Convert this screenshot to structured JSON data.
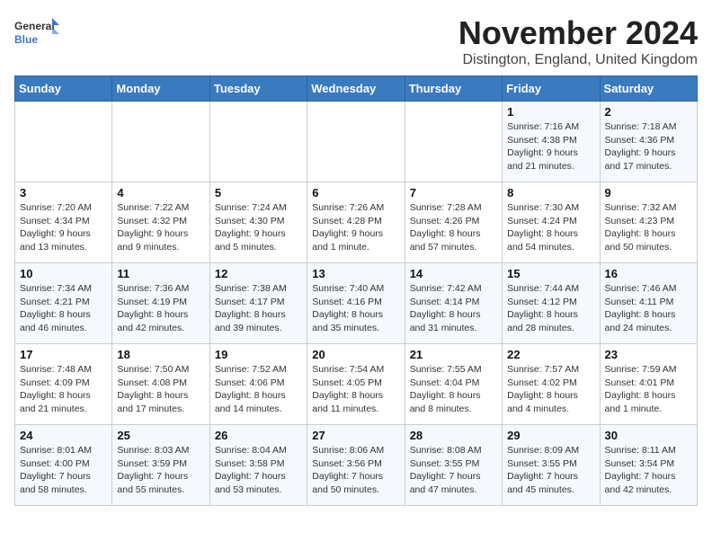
{
  "logo": {
    "general": "General",
    "blue": "Blue"
  },
  "title": "November 2024",
  "subtitle": "Distington, England, United Kingdom",
  "headers": [
    "Sunday",
    "Monday",
    "Tuesday",
    "Wednesday",
    "Thursday",
    "Friday",
    "Saturday"
  ],
  "weeks": [
    [
      {
        "day": "",
        "info": ""
      },
      {
        "day": "",
        "info": ""
      },
      {
        "day": "",
        "info": ""
      },
      {
        "day": "",
        "info": ""
      },
      {
        "day": "",
        "info": ""
      },
      {
        "day": "1",
        "info": "Sunrise: 7:16 AM\nSunset: 4:38 PM\nDaylight: 9 hours\nand 21 minutes."
      },
      {
        "day": "2",
        "info": "Sunrise: 7:18 AM\nSunset: 4:36 PM\nDaylight: 9 hours\nand 17 minutes."
      }
    ],
    [
      {
        "day": "3",
        "info": "Sunrise: 7:20 AM\nSunset: 4:34 PM\nDaylight: 9 hours\nand 13 minutes."
      },
      {
        "day": "4",
        "info": "Sunrise: 7:22 AM\nSunset: 4:32 PM\nDaylight: 9 hours\nand 9 minutes."
      },
      {
        "day": "5",
        "info": "Sunrise: 7:24 AM\nSunset: 4:30 PM\nDaylight: 9 hours\nand 5 minutes."
      },
      {
        "day": "6",
        "info": "Sunrise: 7:26 AM\nSunset: 4:28 PM\nDaylight: 9 hours\nand 1 minute."
      },
      {
        "day": "7",
        "info": "Sunrise: 7:28 AM\nSunset: 4:26 PM\nDaylight: 8 hours\nand 57 minutes."
      },
      {
        "day": "8",
        "info": "Sunrise: 7:30 AM\nSunset: 4:24 PM\nDaylight: 8 hours\nand 54 minutes."
      },
      {
        "day": "9",
        "info": "Sunrise: 7:32 AM\nSunset: 4:23 PM\nDaylight: 8 hours\nand 50 minutes."
      }
    ],
    [
      {
        "day": "10",
        "info": "Sunrise: 7:34 AM\nSunset: 4:21 PM\nDaylight: 8 hours\nand 46 minutes."
      },
      {
        "day": "11",
        "info": "Sunrise: 7:36 AM\nSunset: 4:19 PM\nDaylight: 8 hours\nand 42 minutes."
      },
      {
        "day": "12",
        "info": "Sunrise: 7:38 AM\nSunset: 4:17 PM\nDaylight: 8 hours\nand 39 minutes."
      },
      {
        "day": "13",
        "info": "Sunrise: 7:40 AM\nSunset: 4:16 PM\nDaylight: 8 hours\nand 35 minutes."
      },
      {
        "day": "14",
        "info": "Sunrise: 7:42 AM\nSunset: 4:14 PM\nDaylight: 8 hours\nand 31 minutes."
      },
      {
        "day": "15",
        "info": "Sunrise: 7:44 AM\nSunset: 4:12 PM\nDaylight: 8 hours\nand 28 minutes."
      },
      {
        "day": "16",
        "info": "Sunrise: 7:46 AM\nSunset: 4:11 PM\nDaylight: 8 hours\nand 24 minutes."
      }
    ],
    [
      {
        "day": "17",
        "info": "Sunrise: 7:48 AM\nSunset: 4:09 PM\nDaylight: 8 hours\nand 21 minutes."
      },
      {
        "day": "18",
        "info": "Sunrise: 7:50 AM\nSunset: 4:08 PM\nDaylight: 8 hours\nand 17 minutes."
      },
      {
        "day": "19",
        "info": "Sunrise: 7:52 AM\nSunset: 4:06 PM\nDaylight: 8 hours\nand 14 minutes."
      },
      {
        "day": "20",
        "info": "Sunrise: 7:54 AM\nSunset: 4:05 PM\nDaylight: 8 hours\nand 11 minutes."
      },
      {
        "day": "21",
        "info": "Sunrise: 7:55 AM\nSunset: 4:04 PM\nDaylight: 8 hours\nand 8 minutes."
      },
      {
        "day": "22",
        "info": "Sunrise: 7:57 AM\nSunset: 4:02 PM\nDaylight: 8 hours\nand 4 minutes."
      },
      {
        "day": "23",
        "info": "Sunrise: 7:59 AM\nSunset: 4:01 PM\nDaylight: 8 hours\nand 1 minute."
      }
    ],
    [
      {
        "day": "24",
        "info": "Sunrise: 8:01 AM\nSunset: 4:00 PM\nDaylight: 7 hours\nand 58 minutes."
      },
      {
        "day": "25",
        "info": "Sunrise: 8:03 AM\nSunset: 3:59 PM\nDaylight: 7 hours\nand 55 minutes."
      },
      {
        "day": "26",
        "info": "Sunrise: 8:04 AM\nSunset: 3:58 PM\nDaylight: 7 hours\nand 53 minutes."
      },
      {
        "day": "27",
        "info": "Sunrise: 8:06 AM\nSunset: 3:56 PM\nDaylight: 7 hours\nand 50 minutes."
      },
      {
        "day": "28",
        "info": "Sunrise: 8:08 AM\nSunset: 3:55 PM\nDaylight: 7 hours\nand 47 minutes."
      },
      {
        "day": "29",
        "info": "Sunrise: 8:09 AM\nSunset: 3:55 PM\nDaylight: 7 hours\nand 45 minutes."
      },
      {
        "day": "30",
        "info": "Sunrise: 8:11 AM\nSunset: 3:54 PM\nDaylight: 7 hours\nand 42 minutes."
      }
    ]
  ]
}
